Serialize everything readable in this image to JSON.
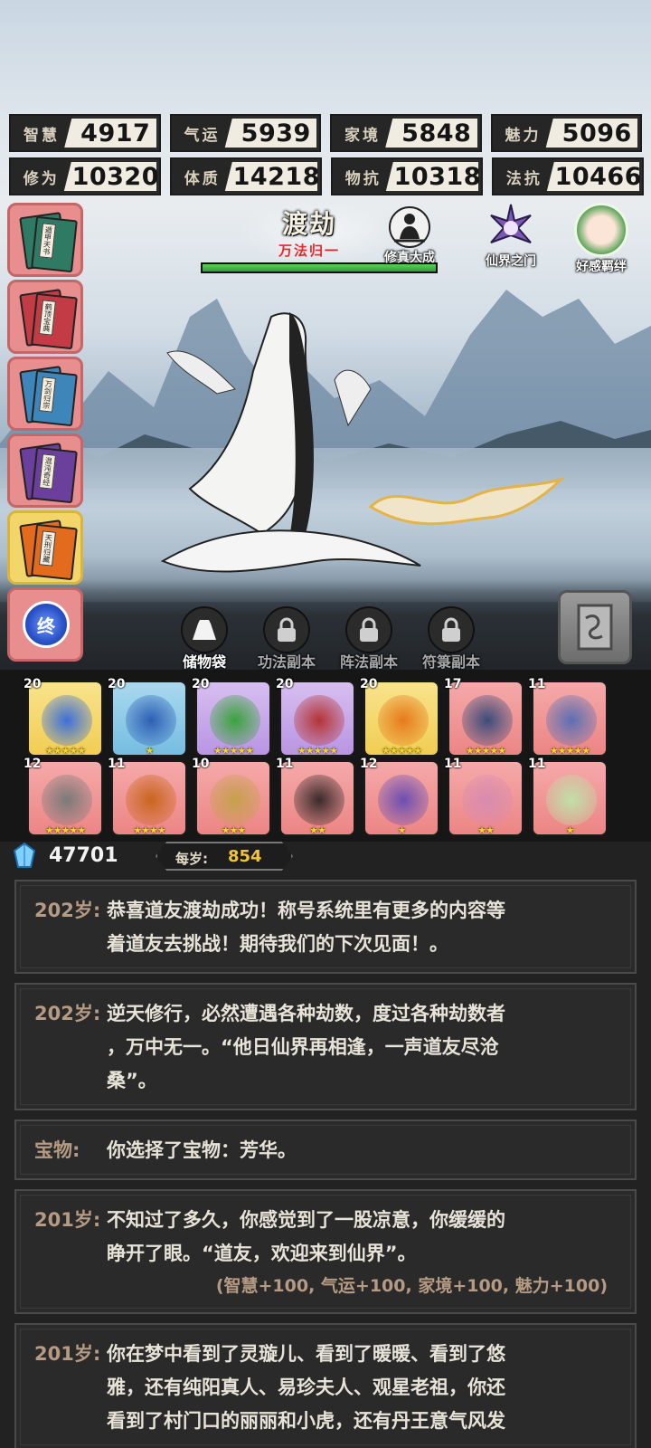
{
  "stats": {
    "row1": [
      {
        "label": "智慧",
        "value": "4917"
      },
      {
        "label": "气运",
        "value": "5939"
      },
      {
        "label": "家境",
        "value": "5848"
      },
      {
        "label": "魅力",
        "value": "5096"
      }
    ],
    "row2": [
      {
        "label": "修为",
        "value": "10320"
      },
      {
        "label": "体质",
        "value": "14218"
      },
      {
        "label": "物抗",
        "value": "10318"
      },
      {
        "label": "法抗",
        "value": "10466"
      }
    ]
  },
  "books": [
    {
      "title": "遁甲天书",
      "color": "#2f7a63"
    },
    {
      "title": "鹤顶宝典",
      "color": "#c23b45"
    },
    {
      "title": "万剑归宗",
      "color": "#3e86b9"
    },
    {
      "title": "混沌奇经",
      "color": "#6b3f9c"
    },
    {
      "title": "天刑归藏",
      "color": "#e36b1e"
    }
  ],
  "end_button": {
    "label": "终"
  },
  "realm": {
    "title": "渡劫",
    "subtitle": "万法归一",
    "progress": 1.0
  },
  "top_icons": {
    "meditate": "修真大成",
    "gate": "仙界之门",
    "bond": "好感羁绊"
  },
  "tabs": [
    {
      "label": "储物袋",
      "locked": false
    },
    {
      "label": "功法副本",
      "locked": true
    },
    {
      "label": "阵法副本",
      "locked": true
    },
    {
      "label": "符箓副本",
      "locked": true
    }
  ],
  "items": [
    {
      "level": "20",
      "stars": 5,
      "rarity": "gold",
      "icon": "orb-icon",
      "tint": "#3c6fd8"
    },
    {
      "level": "20",
      "stars": 1,
      "rarity": "blue",
      "icon": "boots-icon",
      "tint": "#2d5fb5"
    },
    {
      "level": "20",
      "stars": 5,
      "rarity": "purple",
      "icon": "claw-icon",
      "tint": "#3aa33d"
    },
    {
      "level": "20",
      "stars": 5,
      "rarity": "purple",
      "icon": "ring-icon",
      "tint": "#b53434"
    },
    {
      "level": "20",
      "stars": 5,
      "rarity": "gold",
      "icon": "fire-wheel-icon",
      "tint": "#e57a1d"
    },
    {
      "level": "17",
      "stars": 5,
      "rarity": "red",
      "icon": "dagger-icon",
      "tint": "#3c4c7a"
    },
    {
      "level": "11",
      "stars": 5,
      "rarity": "red",
      "icon": "spear-icon",
      "tint": "#5b6fb3"
    },
    {
      "level": "12",
      "stars": 5,
      "rarity": "red",
      "icon": "axe-icon",
      "tint": "#7a7a7a"
    },
    {
      "level": "11",
      "stars": 4,
      "rarity": "red",
      "icon": "cauldron-icon",
      "tint": "#c9651d"
    },
    {
      "level": "10",
      "stars": 3,
      "rarity": "red",
      "icon": "sword-icon",
      "tint": "#c6a04c"
    },
    {
      "level": "11",
      "stars": 2,
      "rarity": "red",
      "icon": "hammer-icon",
      "tint": "#3a2b2b"
    },
    {
      "level": "12",
      "stars": 1,
      "rarity": "red",
      "icon": "mirror-icon",
      "tint": "#6b4fb2"
    },
    {
      "level": "11",
      "stars": 2,
      "rarity": "red",
      "icon": "scroll-icon",
      "tint": "#d88bb0"
    },
    {
      "level": "11",
      "stars": 1,
      "rarity": "red",
      "icon": "jade-seal-icon",
      "tint": "#bfe0a6"
    }
  ],
  "currency": {
    "amount": "47701",
    "age_label": "每岁:",
    "age_value": "854"
  },
  "log": [
    {
      "who": "202岁:",
      "lines": [
        "恭喜道友渡劫成功！称号系统里有更多的内容等",
        "着道友去挑战！期待我们的下次见面！。"
      ],
      "bonus": ""
    },
    {
      "who": "202岁:",
      "lines": [
        "逆天修行，必然遭遇各种劫数，度过各种劫数者",
        "，万中无一。“他日仙界再相逢，一声道友尽沧",
        "桑”。"
      ],
      "bonus": ""
    },
    {
      "who": "宝物:",
      "lines": [
        "你选择了宝物：芳华。"
      ],
      "bonus": ""
    },
    {
      "who": "201岁:",
      "lines": [
        "不知过了多久，你感觉到了一股凉意，你缓缓的",
        "睁开了眼。“道友，欢迎来到仙界”。"
      ],
      "bonus": "(智慧+100, 气运+100, 家境+100, 魅力+100)"
    },
    {
      "who": "201岁:",
      "lines": [
        "你在梦中看到了灵璇儿、看到了暖暖、看到了悠",
        "雅，还有纯阳真人、易珍夫人、观星老祖，你还",
        "看到了村门口的丽丽和小虎，还有丹王意气风发"
      ],
      "bonus": ""
    }
  ]
}
